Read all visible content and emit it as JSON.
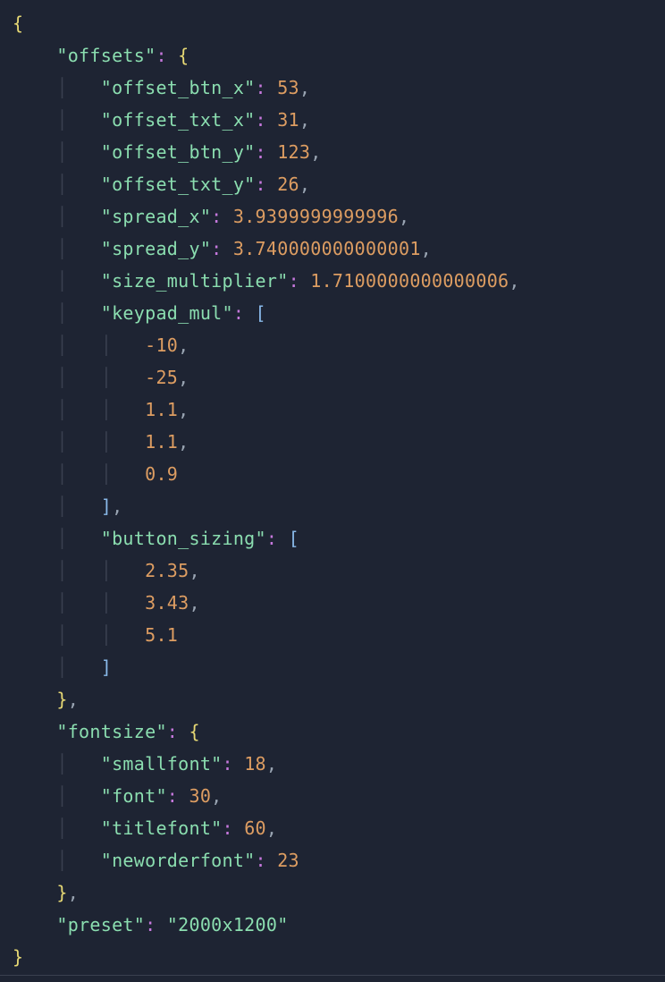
{
  "code": {
    "keys": {
      "offsets": "\"offsets\"",
      "offset_btn_x": "\"offset_btn_x\"",
      "offset_txt_x": "\"offset_txt_x\"",
      "offset_btn_y": "\"offset_btn_y\"",
      "offset_txt_y": "\"offset_txt_y\"",
      "spread_x": "\"spread_x\"",
      "spread_y": "\"spread_y\"",
      "size_multiplier": "\"size_multiplier\"",
      "keypad_mul": "\"keypad_mul\"",
      "button_sizing": "\"button_sizing\"",
      "fontsize": "\"fontsize\"",
      "smallfont": "\"smallfont\"",
      "font": "\"font\"",
      "titlefont": "\"titlefont\"",
      "neworderfont": "\"neworderfont\"",
      "preset": "\"preset\""
    },
    "values": {
      "offset_btn_x": "53",
      "offset_txt_x": "31",
      "offset_btn_y": "123",
      "offset_txt_y": "26",
      "spread_x": "3.9399999999996",
      "spread_y": "3.740000000000001",
      "size_multiplier": "1.7100000000000006",
      "keypad_mul_0": "-10",
      "keypad_mul_1": "-25",
      "keypad_mul_2": "1.1",
      "keypad_mul_3": "1.1",
      "keypad_mul_4": "0.9",
      "button_sizing_0": "2.35",
      "button_sizing_1": "3.43",
      "button_sizing_2": "5.1",
      "smallfont": "18",
      "font": "30",
      "titlefont": "60",
      "neworderfont": "23",
      "preset": "\"2000x1200\""
    },
    "tokens": {
      "open_brace": "{",
      "close_brace": "}",
      "open_bracket": "[",
      "close_bracket": "]",
      "colon": ":",
      "comma": ","
    }
  }
}
